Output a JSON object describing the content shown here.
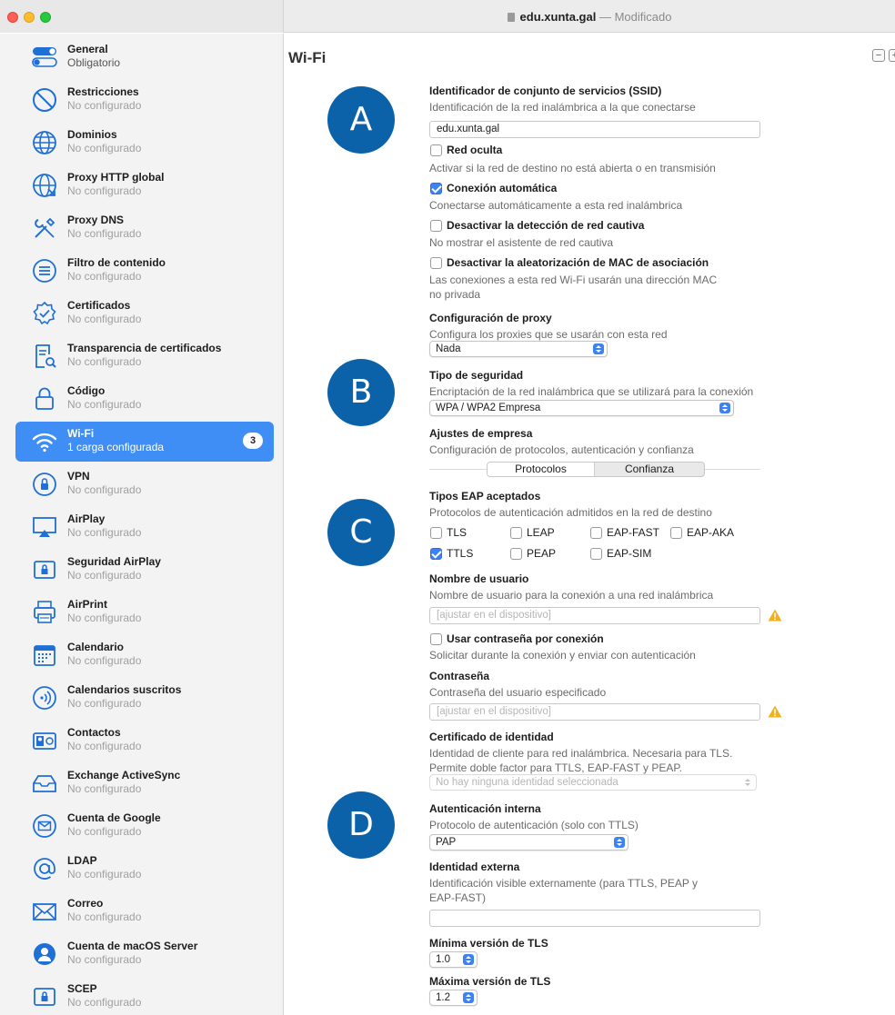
{
  "window": {
    "title_name": "edu.xunta.gal",
    "title_sep": " — ",
    "title_status": "Modificado"
  },
  "sidebar": {
    "items": [
      {
        "title": "General",
        "subtitle": "Obligatorio",
        "icon": "toggle-icon"
      },
      {
        "title": "Restricciones",
        "subtitle": "No configurado",
        "icon": "prohibited-icon"
      },
      {
        "title": "Dominios",
        "subtitle": "No configurado",
        "icon": "globe-icon"
      },
      {
        "title": "Proxy HTTP global",
        "subtitle": "No configurado",
        "icon": "globe-arrows-icon"
      },
      {
        "title": "Proxy DNS",
        "subtitle": "No configurado",
        "icon": "wrench-screwdriver-icon"
      },
      {
        "title": "Filtro de contenido",
        "subtitle": "No configurado",
        "icon": "filter-icon"
      },
      {
        "title": "Certificados",
        "subtitle": "No configurado",
        "icon": "certificate-icon"
      },
      {
        "title": "Transparencia de certificados",
        "subtitle": "No configurado",
        "icon": "document-search-icon"
      },
      {
        "title": "Código",
        "subtitle": "No configurado",
        "icon": "lock-icon"
      },
      {
        "title": "Wi-Fi",
        "subtitle": "1 carga configurada",
        "icon": "wifi-icon",
        "badge": "3"
      },
      {
        "title": "VPN",
        "subtitle": "No configurado",
        "icon": "vpn-shield-icon"
      },
      {
        "title": "AirPlay",
        "subtitle": "No configurado",
        "icon": "airplay-icon"
      },
      {
        "title": "Seguridad AirPlay",
        "subtitle": "No configurado",
        "icon": "airplay-lock-icon"
      },
      {
        "title": "AirPrint",
        "subtitle": "No configurado",
        "icon": "printer-icon"
      },
      {
        "title": "Calendario",
        "subtitle": "No configurado",
        "icon": "calendar-icon"
      },
      {
        "title": "Calendarios suscritos",
        "subtitle": "No configurado",
        "icon": "broadcast-icon"
      },
      {
        "title": "Contactos",
        "subtitle": "No configurado",
        "icon": "contacts-icon"
      },
      {
        "title": "Exchange ActiveSync",
        "subtitle": "No configurado",
        "icon": "inbox-sync-icon"
      },
      {
        "title": "Cuenta de Google",
        "subtitle": "No configurado",
        "icon": "mail-circle-icon"
      },
      {
        "title": "LDAP",
        "subtitle": "No configurado",
        "icon": "at-sign-icon"
      },
      {
        "title": "Correo",
        "subtitle": "No configurado",
        "icon": "envelope-icon"
      },
      {
        "title": "Cuenta de macOS Server",
        "subtitle": "No configurado",
        "icon": "user-circle-icon"
      },
      {
        "title": "SCEP",
        "subtitle": "No configurado",
        "icon": "scep-lock-icon"
      }
    ]
  },
  "main": {
    "title": "Wi-Fi",
    "minus": "−",
    "plus": "+",
    "markers": [
      "A",
      "B",
      "C",
      "D"
    ],
    "ssid": {
      "label": "Identificador de conjunto de servicios (SSID)",
      "desc": "Identificación de la red inalámbrica a la que conectarse",
      "value": "edu.xunta.gal"
    },
    "hidden": {
      "label": "Red oculta",
      "desc": "Activar si la red de destino no está abierta o en transmisión",
      "checked": false
    },
    "autojoin": {
      "label": "Conexión automática",
      "desc": "Conectarse automáticamente a esta red inalámbrica",
      "checked": true
    },
    "captive": {
      "label": "Desactivar la detección de red cautiva",
      "desc": "No mostrar el asistente de red cautiva",
      "checked": false
    },
    "mac": {
      "label": "Desactivar la aleatorización de MAC de asociación",
      "desc1": "Las conexiones a esta red Wi-Fi usarán una dirección MAC",
      "desc2": "no privada",
      "checked": false
    },
    "proxy": {
      "label": "Configuración de proxy",
      "desc": "Configura los proxies que se usarán con esta red",
      "value": "Nada"
    },
    "security": {
      "label": "Tipo de seguridad",
      "desc": "Encriptación de la red inalámbrica que se utilizará para la conexión",
      "value": "WPA / WPA2 Empresa"
    },
    "enterprise": {
      "label": "Ajustes de empresa",
      "desc": "Configuración de protocolos, autenticación y confianza",
      "tabs": [
        "Protocolos",
        "Confianza"
      ],
      "selected": "Protocolos"
    },
    "eap": {
      "label": "Tipos EAP aceptados",
      "desc": "Protocolos de autenticación admitidos en la red de destino",
      "options": [
        {
          "name": "TLS",
          "checked": false
        },
        {
          "name": "LEAP",
          "checked": false
        },
        {
          "name": "EAP-FAST",
          "checked": false
        },
        {
          "name": "EAP-AKA",
          "checked": false
        },
        {
          "name": "TTLS",
          "checked": true
        },
        {
          "name": "PEAP",
          "checked": false
        },
        {
          "name": "EAP-SIM",
          "checked": false
        }
      ]
    },
    "username": {
      "label": "Nombre de usuario",
      "desc": "Nombre de usuario para la conexión a una red inalámbrica",
      "placeholder": "[ajustar en el dispositivo]"
    },
    "per_connection": {
      "label": "Usar contraseña por conexión",
      "desc": "Solicitar durante la conexión y enviar con autenticación",
      "checked": false
    },
    "password": {
      "label": "Contraseña",
      "desc": "Contraseña del usuario especificado",
      "placeholder": "[ajustar en el dispositivo]"
    },
    "identity_cert": {
      "label": "Certificado de identidad",
      "desc1": "Identidad de cliente para red inalámbrica. Necesaria para TLS.",
      "desc2": "Permite doble factor para TTLS, EAP-FAST y PEAP.",
      "value": "No hay ninguna identidad seleccionada"
    },
    "inner_auth": {
      "label": "Autenticación interna",
      "desc": "Protocolo de autenticación (solo con TTLS)",
      "value": "PAP"
    },
    "outer_identity": {
      "label": "Identidad externa",
      "desc1": "Identificación visible externamente (para TTLS, PEAP y",
      "desc2": "EAP-FAST)",
      "value": ""
    },
    "tls_min": {
      "label": "Mínima versión de TLS",
      "value": "1.0"
    },
    "tls_max": {
      "label": "Máxima versión de TLS",
      "value": "1.2"
    }
  },
  "colors": {
    "accent": "#3b82f6",
    "sidebar_selected": "#3f8ef5",
    "marker": "#0b62a9",
    "warning": "#f2b01e"
  }
}
